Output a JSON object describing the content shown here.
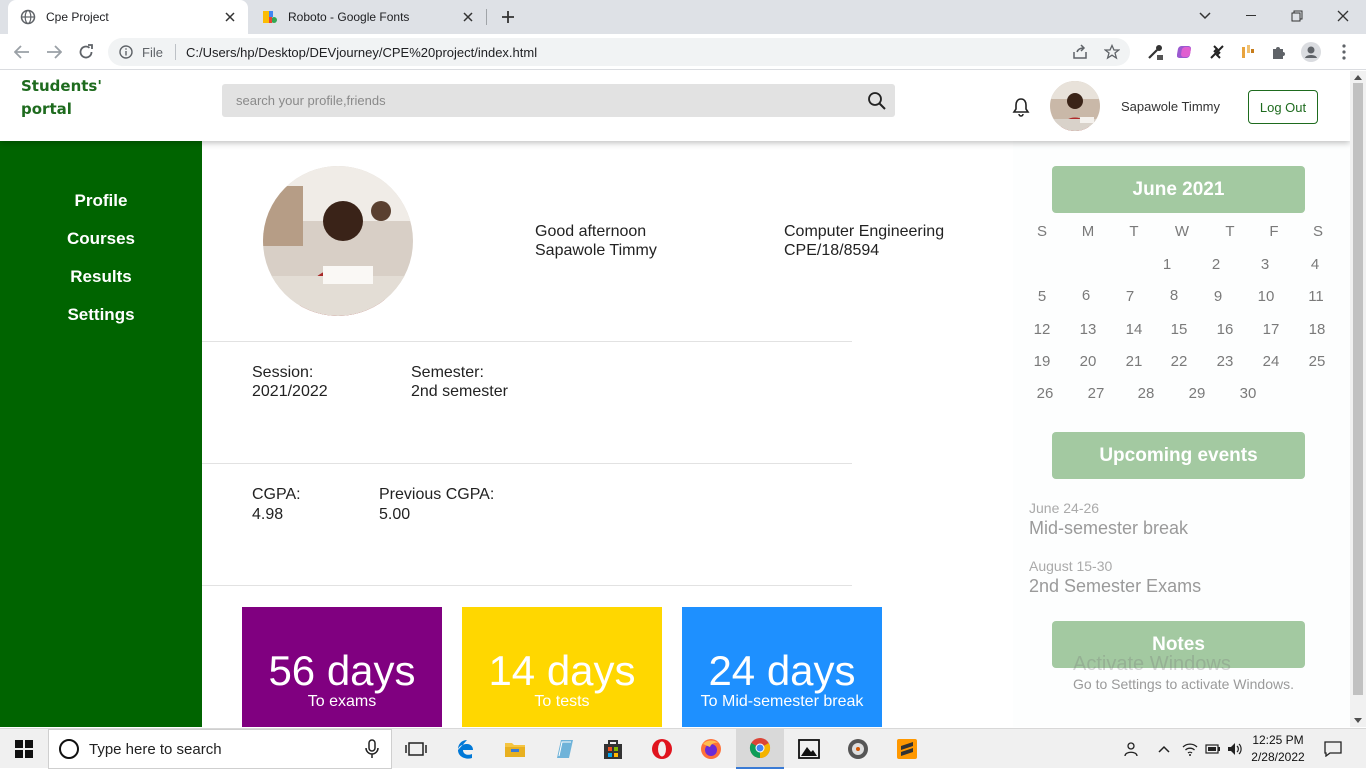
{
  "browser": {
    "tabs": [
      {
        "title": "Cpe Project",
        "active": true
      },
      {
        "title": "Roboto - Google Fonts",
        "active": false
      }
    ],
    "scheme_label": "File",
    "url": "C:/Users/hp/Desktop/DEVjourney/CPE%20project/index.html"
  },
  "header": {
    "brand_line1": "Students'",
    "brand_line2": "portal",
    "search_placeholder": "search your profile,friends",
    "user_name": "Sapawole Timmy",
    "logout_label": "Log Out"
  },
  "sidebar": {
    "items": [
      {
        "label": "Profile"
      },
      {
        "label": "Courses"
      },
      {
        "label": "Results"
      },
      {
        "label": "Settings"
      }
    ]
  },
  "profile": {
    "greeting": "Good afternoon",
    "name": "Sapawole Timmy",
    "department": "Computer Engineering",
    "matric_no": "CPE/18/8594"
  },
  "session": {
    "session_label": "Session:",
    "session_value": "2021/2022",
    "semester_label": "Semester:",
    "semester_value": "2nd semester"
  },
  "gpa": {
    "cgpa_label": "CGPA:",
    "cgpa_value": "4.98",
    "prev_label": "Previous CGPA:",
    "prev_value": "5.00"
  },
  "countdowns": [
    {
      "days": "56 days",
      "label": "To exams",
      "color": "#800080"
    },
    {
      "days": "14 days",
      "label": "To tests",
      "color": "#ffd700"
    },
    {
      "days": "24 days",
      "label": "To Mid-semester break",
      "color": "#1e90ff"
    }
  ],
  "calendar": {
    "title": "June 2021",
    "weekdays": [
      "S",
      "M",
      "T",
      "W",
      "T",
      "F",
      "S"
    ],
    "weeks": [
      [
        "",
        "",
        "",
        "1",
        "2",
        "3",
        "4"
      ],
      [
        "5",
        "6",
        "7",
        "8",
        "9",
        "10",
        "11"
      ],
      [
        "12",
        "13",
        "14",
        "15",
        "16",
        "17",
        "18"
      ],
      [
        "19",
        "20",
        "21",
        "22",
        "23",
        "24",
        "25"
      ],
      [
        "26",
        "27",
        "28",
        "29",
        "30",
        "",
        ""
      ]
    ]
  },
  "events": {
    "title": "Upcoming events",
    "items": [
      {
        "date": "June 24-26",
        "name": "Mid-semester break"
      },
      {
        "date": "August 15-30",
        "name": "2nd Semester Exams"
      }
    ]
  },
  "notes": {
    "title": "Notes"
  },
  "watermark": {
    "title": "Activate Windows",
    "subtitle": "Go to Settings to activate Windows."
  },
  "taskbar": {
    "search_placeholder": "Type here to search",
    "time": "12:25 PM",
    "date": "2/28/2022"
  },
  "colors": {
    "sidebar_green": "#006400",
    "accent_green": "#1e6b1e",
    "panel_button": "#a3c9a1"
  }
}
